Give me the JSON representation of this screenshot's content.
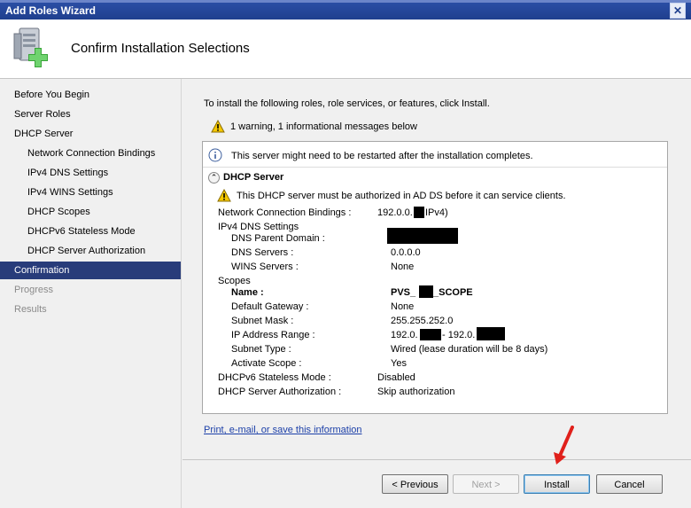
{
  "window": {
    "title": "Add Roles Wizard",
    "close_glyph": "✕"
  },
  "header": {
    "title": "Confirm Installation Selections",
    "icon": "server-add-icon"
  },
  "nav": {
    "items": [
      {
        "label": "Before You Begin",
        "state": "normal",
        "level": 0
      },
      {
        "label": "Server Roles",
        "state": "normal",
        "level": 0
      },
      {
        "label": "DHCP Server",
        "state": "normal",
        "level": 0
      },
      {
        "label": "Network Connection Bindings",
        "state": "normal",
        "level": 1
      },
      {
        "label": "IPv4 DNS Settings",
        "state": "normal",
        "level": 1
      },
      {
        "label": "IPv4 WINS Settings",
        "state": "normal",
        "level": 1
      },
      {
        "label": "DHCP Scopes",
        "state": "normal",
        "level": 1
      },
      {
        "label": "DHCPv6 Stateless Mode",
        "state": "normal",
        "level": 1
      },
      {
        "label": "DHCP Server Authorization",
        "state": "normal",
        "level": 1
      },
      {
        "label": "Confirmation",
        "state": "active",
        "level": 0
      },
      {
        "label": "Progress",
        "state": "disabled",
        "level": 0
      },
      {
        "label": "Results",
        "state": "disabled",
        "level": 0
      }
    ]
  },
  "main": {
    "intro": "To install the following roles, role services, or features, click Install.",
    "summary_warning": "1 warning, 1 informational messages below",
    "info_message": "This server might need to be restarted after the installation completes.",
    "section_title": "DHCP Server",
    "section_warning": "This DHCP server must be authorized in AD DS before it can service clients.",
    "details": {
      "ncb_label": "Network Connection Bindings :",
      "ncb_value_a": "192.0.0.",
      "ncb_value_b": "IPv4)",
      "ipv4dns_label": "IPv4 DNS Settings",
      "dns_parent_label": "DNS Parent Domain :",
      "dns_servers_label": "DNS Servers :",
      "dns_servers_value": "0.0.0.0",
      "wins_label": "WINS Servers :",
      "wins_value": "None",
      "scopes_label": "Scopes",
      "name_label": "Name :",
      "name_value_a": "PVS_",
      "name_value_b": "_SCOPE",
      "gateway_label": "Default Gateway :",
      "gateway_value": "None",
      "mask_label": "Subnet Mask :",
      "mask_value": "255.255.252.0",
      "range_label": "IP Address Range :",
      "range_value_a": "192.0.",
      "range_value_b": "- 192.0.",
      "subnet_type_label": "Subnet Type :",
      "subnet_type_value": "Wired (lease duration will be 8 days)",
      "activate_label": "Activate Scope :",
      "activate_value": "Yes",
      "dhcpv6_label": "DHCPv6 Stateless Mode :",
      "dhcpv6_value": "Disabled",
      "auth_label": "DHCP Server Authorization :",
      "auth_value": "Skip authorization"
    },
    "link": "Print, e-mail, or save this information"
  },
  "buttons": {
    "previous": "< Previous",
    "next": "Next >",
    "install": "Install",
    "cancel": "Cancel"
  },
  "colors": {
    "active_nav": "#283c7a",
    "titlebar": "#1f3f8e",
    "link": "#1b3fa8",
    "arrow": "#e0201b"
  }
}
